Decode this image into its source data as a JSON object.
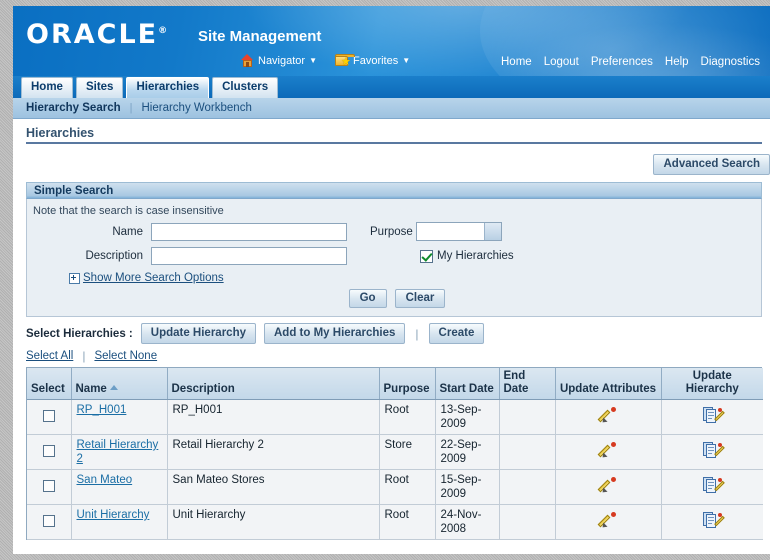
{
  "branding": {
    "logo_text": "ORACLE",
    "logo_reg": "®",
    "app_title": "Site Management",
    "menus": [
      {
        "label": "Navigator",
        "icon": "home-icon",
        "caret": "▼"
      },
      {
        "label": "Favorites",
        "icon": "favorites-folder-star-icon",
        "caret": "▼"
      }
    ],
    "global_links": [
      "Home",
      "Logout",
      "Preferences",
      "Help",
      "Diagnostics"
    ]
  },
  "tabs": [
    {
      "label": "Home",
      "active": false
    },
    {
      "label": "Sites",
      "active": false
    },
    {
      "label": "Hierarchies",
      "active": true
    },
    {
      "label": "Clusters",
      "active": false
    }
  ],
  "subnav": {
    "current": "Hierarchy Search",
    "separator": "|",
    "links": [
      "Hierarchy Workbench"
    ]
  },
  "page": {
    "title": "Hierarchies",
    "advanced_search_label": "Advanced Search"
  },
  "simple_search": {
    "heading": "Simple Search",
    "note": "Note that the search is case insensitive",
    "name_label": "Name",
    "name_value": "",
    "description_label": "Description",
    "description_value": "",
    "purpose_label": "Purpose",
    "purpose_value": "",
    "purpose_options": [
      ""
    ],
    "my_hierarchies_label": "My Hierarchies",
    "my_hierarchies_checked": true,
    "show_more_label": "Show More Search Options",
    "go_label": "Go",
    "clear_label": "Clear"
  },
  "toolbar": {
    "select_label": "Select Hierarchies :",
    "update_hierarchy_label": "Update Hierarchy",
    "add_to_my_hierarchies_label": "Add to My Hierarchies",
    "separator": "|",
    "create_label": "Create",
    "select_all_label": "Select All",
    "select_none_label": "Select None",
    "links_separator": "|"
  },
  "results_table": {
    "columns": [
      "Select",
      "Name",
      "Description",
      "Purpose",
      "Start Date",
      "End Date",
      "Update Attributes",
      "Update Hierarchy"
    ],
    "sort_column": "Name",
    "sort_direction": "ascending",
    "rows": [
      {
        "selected": false,
        "name": "RP_H001",
        "description": "RP_H001",
        "purpose": "Root",
        "start_date": "13-Sep-2009",
        "end_date": "",
        "update_attributes_icon": "pencil-icon",
        "update_hierarchy_icon": "document-pencil-icon"
      },
      {
        "selected": false,
        "name": "Retail Hierarchy 2",
        "description": "Retail Hierarchy 2",
        "purpose": "Store",
        "start_date": "22-Sep-2009",
        "end_date": "",
        "update_attributes_icon": "pencil-icon",
        "update_hierarchy_icon": "document-pencil-icon"
      },
      {
        "selected": false,
        "name": "San Mateo",
        "description": "San Mateo Stores",
        "purpose": "Root",
        "start_date": "15-Sep-2009",
        "end_date": "",
        "update_attributes_icon": "pencil-icon",
        "update_hierarchy_icon": "document-pencil-icon"
      },
      {
        "selected": false,
        "name": "Unit Hierarchy",
        "description": "Unit Hierarchy",
        "purpose": "Root",
        "start_date": "24-Nov-2008",
        "end_date": "",
        "update_attributes_icon": "pencil-icon",
        "update_hierarchy_icon": "document-pencil-icon"
      }
    ]
  },
  "colors": {
    "brand_blue": "#1279c9",
    "tab_active": "#b9d7ee",
    "panel_bg": "#e9eff4",
    "link": "#1b6ea5",
    "header_row": "#c3d8e9"
  }
}
